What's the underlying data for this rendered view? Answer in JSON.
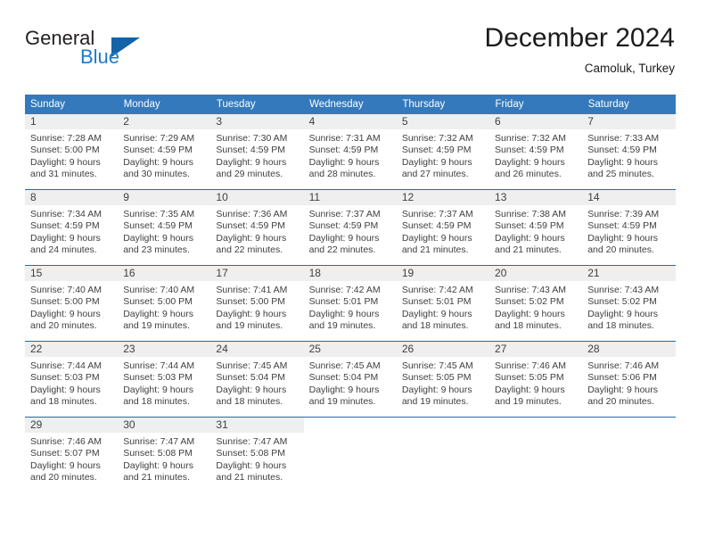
{
  "brand": {
    "name_top": "General",
    "name_bottom": "Blue",
    "color_dark": "#231f20",
    "color_blue": "#1f7ac4",
    "triangle_color": "#1263a8"
  },
  "header": {
    "title": "December 2024",
    "location": "Camoluk, Turkey"
  },
  "theme": {
    "header_row_bg": "#3479bb",
    "header_row_text": "#ffffff",
    "week_separator": "#1f6cb0",
    "daynum_band_bg": "#efefef",
    "body_text": "#3f3f3f"
  },
  "weekdays": [
    "Sunday",
    "Monday",
    "Tuesday",
    "Wednesday",
    "Thursday",
    "Friday",
    "Saturday"
  ],
  "weeks": [
    [
      {
        "day": "1",
        "sunrise": "Sunrise: 7:28 AM",
        "sunset": "Sunset: 5:00 PM",
        "daylight1": "Daylight: 9 hours",
        "daylight2": "and 31 minutes."
      },
      {
        "day": "2",
        "sunrise": "Sunrise: 7:29 AM",
        "sunset": "Sunset: 4:59 PM",
        "daylight1": "Daylight: 9 hours",
        "daylight2": "and 30 minutes."
      },
      {
        "day": "3",
        "sunrise": "Sunrise: 7:30 AM",
        "sunset": "Sunset: 4:59 PM",
        "daylight1": "Daylight: 9 hours",
        "daylight2": "and 29 minutes."
      },
      {
        "day": "4",
        "sunrise": "Sunrise: 7:31 AM",
        "sunset": "Sunset: 4:59 PM",
        "daylight1": "Daylight: 9 hours",
        "daylight2": "and 28 minutes."
      },
      {
        "day": "5",
        "sunrise": "Sunrise: 7:32 AM",
        "sunset": "Sunset: 4:59 PM",
        "daylight1": "Daylight: 9 hours",
        "daylight2": "and 27 minutes."
      },
      {
        "day": "6",
        "sunrise": "Sunrise: 7:32 AM",
        "sunset": "Sunset: 4:59 PM",
        "daylight1": "Daylight: 9 hours",
        "daylight2": "and 26 minutes."
      },
      {
        "day": "7",
        "sunrise": "Sunrise: 7:33 AM",
        "sunset": "Sunset: 4:59 PM",
        "daylight1": "Daylight: 9 hours",
        "daylight2": "and 25 minutes."
      }
    ],
    [
      {
        "day": "8",
        "sunrise": "Sunrise: 7:34 AM",
        "sunset": "Sunset: 4:59 PM",
        "daylight1": "Daylight: 9 hours",
        "daylight2": "and 24 minutes."
      },
      {
        "day": "9",
        "sunrise": "Sunrise: 7:35 AM",
        "sunset": "Sunset: 4:59 PM",
        "daylight1": "Daylight: 9 hours",
        "daylight2": "and 23 minutes."
      },
      {
        "day": "10",
        "sunrise": "Sunrise: 7:36 AM",
        "sunset": "Sunset: 4:59 PM",
        "daylight1": "Daylight: 9 hours",
        "daylight2": "and 22 minutes."
      },
      {
        "day": "11",
        "sunrise": "Sunrise: 7:37 AM",
        "sunset": "Sunset: 4:59 PM",
        "daylight1": "Daylight: 9 hours",
        "daylight2": "and 22 minutes."
      },
      {
        "day": "12",
        "sunrise": "Sunrise: 7:37 AM",
        "sunset": "Sunset: 4:59 PM",
        "daylight1": "Daylight: 9 hours",
        "daylight2": "and 21 minutes."
      },
      {
        "day": "13",
        "sunrise": "Sunrise: 7:38 AM",
        "sunset": "Sunset: 4:59 PM",
        "daylight1": "Daylight: 9 hours",
        "daylight2": "and 21 minutes."
      },
      {
        "day": "14",
        "sunrise": "Sunrise: 7:39 AM",
        "sunset": "Sunset: 4:59 PM",
        "daylight1": "Daylight: 9 hours",
        "daylight2": "and 20 minutes."
      }
    ],
    [
      {
        "day": "15",
        "sunrise": "Sunrise: 7:40 AM",
        "sunset": "Sunset: 5:00 PM",
        "daylight1": "Daylight: 9 hours",
        "daylight2": "and 20 minutes."
      },
      {
        "day": "16",
        "sunrise": "Sunrise: 7:40 AM",
        "sunset": "Sunset: 5:00 PM",
        "daylight1": "Daylight: 9 hours",
        "daylight2": "and 19 minutes."
      },
      {
        "day": "17",
        "sunrise": "Sunrise: 7:41 AM",
        "sunset": "Sunset: 5:00 PM",
        "daylight1": "Daylight: 9 hours",
        "daylight2": "and 19 minutes."
      },
      {
        "day": "18",
        "sunrise": "Sunrise: 7:42 AM",
        "sunset": "Sunset: 5:01 PM",
        "daylight1": "Daylight: 9 hours",
        "daylight2": "and 19 minutes."
      },
      {
        "day": "19",
        "sunrise": "Sunrise: 7:42 AM",
        "sunset": "Sunset: 5:01 PM",
        "daylight1": "Daylight: 9 hours",
        "daylight2": "and 18 minutes."
      },
      {
        "day": "20",
        "sunrise": "Sunrise: 7:43 AM",
        "sunset": "Sunset: 5:02 PM",
        "daylight1": "Daylight: 9 hours",
        "daylight2": "and 18 minutes."
      },
      {
        "day": "21",
        "sunrise": "Sunrise: 7:43 AM",
        "sunset": "Sunset: 5:02 PM",
        "daylight1": "Daylight: 9 hours",
        "daylight2": "and 18 minutes."
      }
    ],
    [
      {
        "day": "22",
        "sunrise": "Sunrise: 7:44 AM",
        "sunset": "Sunset: 5:03 PM",
        "daylight1": "Daylight: 9 hours",
        "daylight2": "and 18 minutes."
      },
      {
        "day": "23",
        "sunrise": "Sunrise: 7:44 AM",
        "sunset": "Sunset: 5:03 PM",
        "daylight1": "Daylight: 9 hours",
        "daylight2": "and 18 minutes."
      },
      {
        "day": "24",
        "sunrise": "Sunrise: 7:45 AM",
        "sunset": "Sunset: 5:04 PM",
        "daylight1": "Daylight: 9 hours",
        "daylight2": "and 18 minutes."
      },
      {
        "day": "25",
        "sunrise": "Sunrise: 7:45 AM",
        "sunset": "Sunset: 5:04 PM",
        "daylight1": "Daylight: 9 hours",
        "daylight2": "and 19 minutes."
      },
      {
        "day": "26",
        "sunrise": "Sunrise: 7:45 AM",
        "sunset": "Sunset: 5:05 PM",
        "daylight1": "Daylight: 9 hours",
        "daylight2": "and 19 minutes."
      },
      {
        "day": "27",
        "sunrise": "Sunrise: 7:46 AM",
        "sunset": "Sunset: 5:05 PM",
        "daylight1": "Daylight: 9 hours",
        "daylight2": "and 19 minutes."
      },
      {
        "day": "28",
        "sunrise": "Sunrise: 7:46 AM",
        "sunset": "Sunset: 5:06 PM",
        "daylight1": "Daylight: 9 hours",
        "daylight2": "and 20 minutes."
      }
    ],
    [
      {
        "day": "29",
        "sunrise": "Sunrise: 7:46 AM",
        "sunset": "Sunset: 5:07 PM",
        "daylight1": "Daylight: 9 hours",
        "daylight2": "and 20 minutes."
      },
      {
        "day": "30",
        "sunrise": "Sunrise: 7:47 AM",
        "sunset": "Sunset: 5:08 PM",
        "daylight1": "Daylight: 9 hours",
        "daylight2": "and 21 minutes."
      },
      {
        "day": "31",
        "sunrise": "Sunrise: 7:47 AM",
        "sunset": "Sunset: 5:08 PM",
        "daylight1": "Daylight: 9 hours",
        "daylight2": "and 21 minutes."
      },
      {
        "day": "",
        "sunrise": "",
        "sunset": "",
        "daylight1": "",
        "daylight2": ""
      },
      {
        "day": "",
        "sunrise": "",
        "sunset": "",
        "daylight1": "",
        "daylight2": ""
      },
      {
        "day": "",
        "sunrise": "",
        "sunset": "",
        "daylight1": "",
        "daylight2": ""
      },
      {
        "day": "",
        "sunrise": "",
        "sunset": "",
        "daylight1": "",
        "daylight2": ""
      }
    ]
  ]
}
